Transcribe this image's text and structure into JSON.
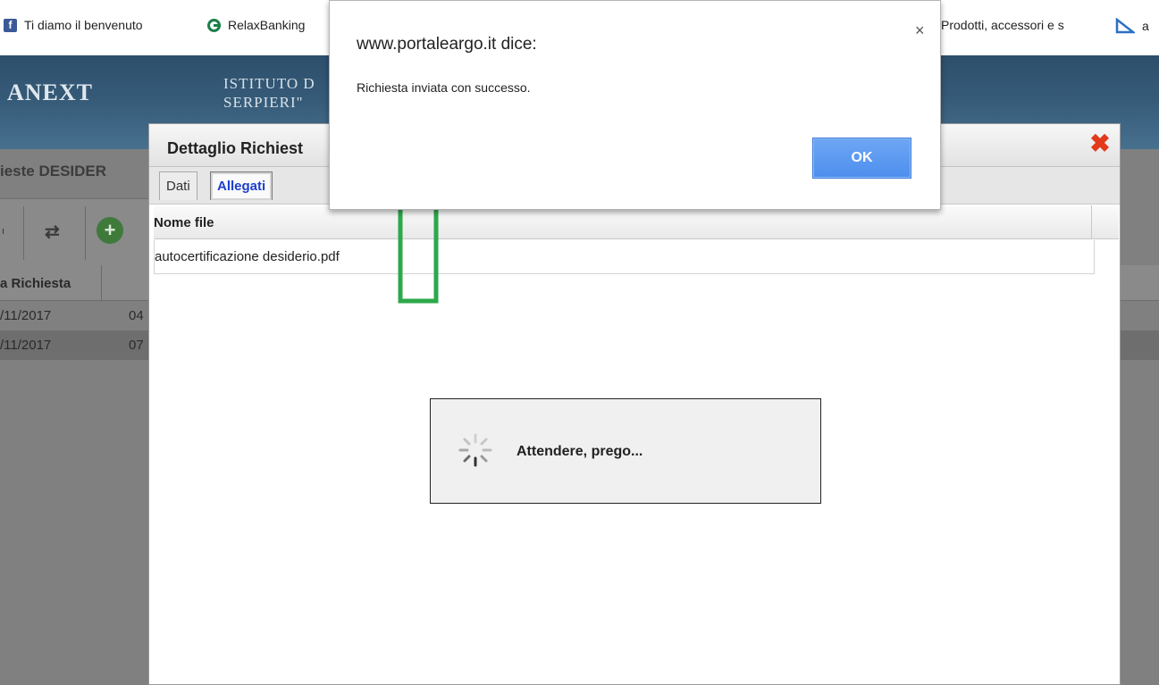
{
  "browser": {
    "bookmarks": [
      {
        "label": "Ti diamo il benvenuto",
        "icon": "facebook-icon",
        "color": "#3b5998"
      },
      {
        "label": "RelaxBanking",
        "icon": "relaxbanking-icon",
        "color": "#1b7f4a"
      },
      {
        "label": "Prodotti, accessori e s",
        "icon": "",
        "color": ""
      },
      {
        "label": "a",
        "icon": "triangle-ruler-icon",
        "color": "#2b6fc4"
      }
    ]
  },
  "header": {
    "logo": "ANEXT",
    "school_line1": "ISTITUTO D",
    "school_line2": "SERPIERI\""
  },
  "background_grid": {
    "title": "ieste DESIDER",
    "toolbar_left_text": "ı",
    "refresh_icon": "refresh-icon",
    "add_icon": "add-icon",
    "column_header": "a Richiesta",
    "rows": [
      {
        "c1": "/11/2017",
        "c2": "04"
      },
      {
        "c1": "/11/2017",
        "c2": "07"
      }
    ]
  },
  "detail": {
    "title": "Dettaglio Richiest",
    "close_icon": "close-icon",
    "tabs": [
      {
        "label": "Dati",
        "active": false
      },
      {
        "label": "Allegati",
        "active": true
      }
    ],
    "file_table": {
      "column_header": "Nome file",
      "rows": [
        "autocertificazione desiderio.pdf"
      ]
    }
  },
  "wait": {
    "text": "Attendere, prego..."
  },
  "alert": {
    "title": "www.portaleargo.it dice:",
    "message": "Richiesta inviata con successo.",
    "ok_label": "OK",
    "close_symbol": "×"
  },
  "colors": {
    "arrow": "#2da84a",
    "ok_button": "#5b98f0",
    "close_red": "#e23a1b",
    "header_blue": "#355a77"
  }
}
